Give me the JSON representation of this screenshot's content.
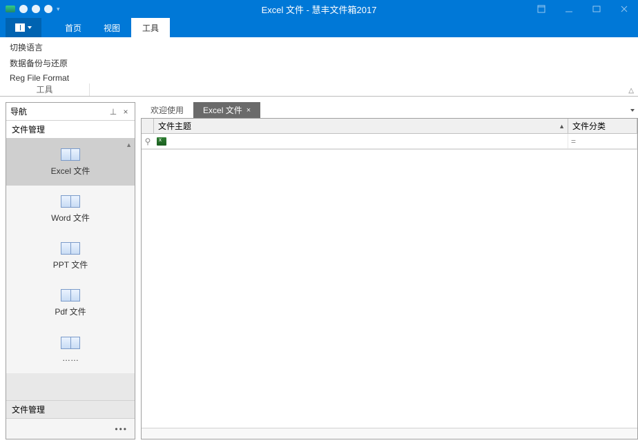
{
  "window": {
    "title": "Excel 文件 - 慧丰文件箱2017"
  },
  "ribbon": {
    "file_label": "",
    "tabs": [
      {
        "label": "首页"
      },
      {
        "label": "视图"
      },
      {
        "label": "工具"
      }
    ],
    "active_tab_index": 2,
    "tool_group": {
      "items": [
        "切换语言",
        "数据备份与还原",
        "Reg File Format"
      ],
      "group_label": "工具"
    }
  },
  "nav": {
    "header": "导航",
    "section_title": "文件管理",
    "items": [
      {
        "label": "Excel 文件",
        "selected": true
      },
      {
        "label": "Word 文件"
      },
      {
        "label": "PPT 文件"
      },
      {
        "label": "Pdf 文件"
      },
      {
        "label": "……"
      }
    ],
    "bottom_label": "文件管理",
    "more_label": "•••"
  },
  "documents": {
    "tabs": [
      {
        "label": "欢迎使用",
        "active": false,
        "closable": false
      },
      {
        "label": "Excel 文件",
        "active": true,
        "closable": true
      }
    ]
  },
  "grid": {
    "columns": [
      {
        "label": "文件主题",
        "sortable": true
      },
      {
        "label": "文件分类",
        "sortable": false
      }
    ],
    "filter_category_placeholder": "="
  }
}
